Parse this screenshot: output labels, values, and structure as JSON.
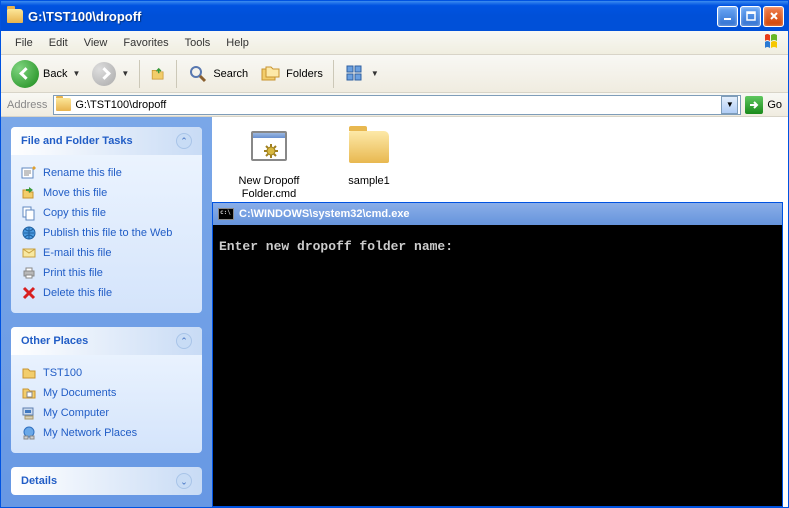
{
  "window": {
    "title": "G:\\TST100\\dropoff"
  },
  "menu": {
    "file": "File",
    "edit": "Edit",
    "view": "View",
    "favorites": "Favorites",
    "tools": "Tools",
    "help": "Help"
  },
  "toolbar": {
    "back": "Back",
    "search": "Search",
    "folders": "Folders"
  },
  "address": {
    "label": "Address",
    "value": "G:\\TST100\\dropoff",
    "go": "Go"
  },
  "sidebar": {
    "tasks_header": "File and Folder Tasks",
    "tasks": [
      {
        "label": "Rename this file"
      },
      {
        "label": "Move this file"
      },
      {
        "label": "Copy this file"
      },
      {
        "label": "Publish this file to the Web"
      },
      {
        "label": "E-mail this file"
      },
      {
        "label": "Print this file"
      },
      {
        "label": "Delete this file"
      }
    ],
    "places_header": "Other Places",
    "places": [
      {
        "label": "TST100"
      },
      {
        "label": "My Documents"
      },
      {
        "label": "My Computer"
      },
      {
        "label": "My Network Places"
      }
    ],
    "details_header": "Details"
  },
  "files": [
    {
      "label": "New Dropoff Folder.cmd"
    },
    {
      "label": "sample1"
    }
  ],
  "cmd": {
    "title": "C:\\WINDOWS\\system32\\cmd.exe",
    "body": "Enter new dropoff folder name:"
  }
}
